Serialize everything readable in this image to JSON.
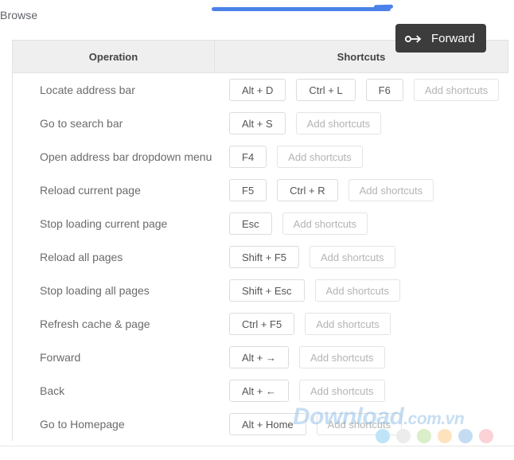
{
  "page": {
    "label": "Browse",
    "accent_color": "#4a82e8"
  },
  "tooltip": {
    "label": "Forward",
    "icon": "key-arrow-icon",
    "background": "#3c3c3c",
    "text_color": "#ffffff"
  },
  "table": {
    "headers": {
      "operation": "Operation",
      "shortcuts": "Shortcuts"
    },
    "add_label": "Add shortcuts",
    "rows": [
      {
        "operation": "Locate address bar",
        "shortcuts": [
          "Alt + D",
          "Ctrl + L",
          "F6"
        ]
      },
      {
        "operation": "Go to search bar",
        "shortcuts": [
          "Alt + S"
        ]
      },
      {
        "operation": "Open address bar dropdown menu",
        "shortcuts": [
          "F4"
        ]
      },
      {
        "operation": "Reload current page",
        "shortcuts": [
          "F5",
          "Ctrl + R"
        ]
      },
      {
        "operation": "Stop loading current page",
        "shortcuts": [
          "Esc"
        ]
      },
      {
        "operation": "Reload all pages",
        "shortcuts": [
          "Shift + F5"
        ]
      },
      {
        "operation": "Stop loading all pages",
        "shortcuts": [
          "Shift + Esc"
        ]
      },
      {
        "operation": "Refresh cache & page",
        "shortcuts": [
          "Ctrl + F5"
        ]
      },
      {
        "operation": "Forward",
        "shortcuts": [
          "Alt + →"
        ]
      },
      {
        "operation": "Back",
        "shortcuts": [
          "Alt + ←"
        ]
      },
      {
        "operation": "Go to Homepage",
        "shortcuts": [
          "Alt + Home"
        ]
      }
    ]
  },
  "watermark": {
    "name": "Download",
    "tld": ".com.vn",
    "dots": [
      "#bfe4f7",
      "#ececec",
      "#daeec9",
      "#fde3bd",
      "#c3dcf2",
      "#fbd2d6"
    ]
  }
}
